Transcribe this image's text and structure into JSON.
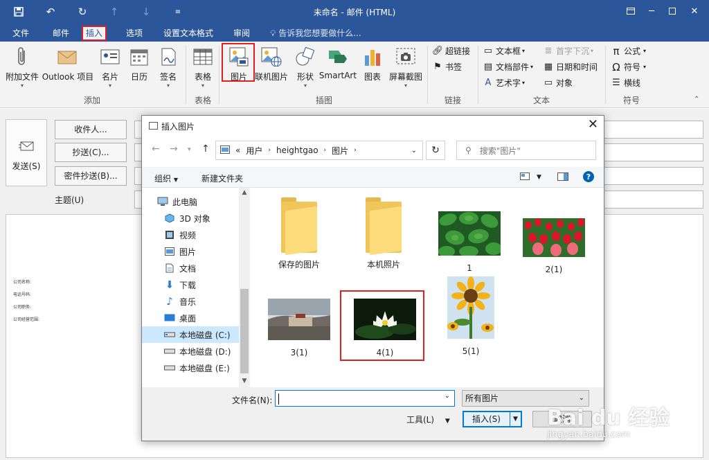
{
  "window": {
    "title": "未命名 - 邮件 (HTML)"
  },
  "ribbon_tabs": [
    "文件",
    "邮件",
    "插入",
    "选项",
    "设置文本格式",
    "审阅"
  ],
  "tell_me": "告诉我您想要做什么...",
  "ribbon": {
    "add": {
      "attach": "附加文件",
      "outlook_item": "Outlook 项目",
      "card": "名片",
      "calendar": "日历",
      "signature": "签名",
      "group": "添加"
    },
    "tables": {
      "table": "表格",
      "group": "表格"
    },
    "illustrations": {
      "picture": "图片",
      "online_picture": "联机图片",
      "shapes": "形状",
      "smartart": "SmartArt",
      "chart": "图表",
      "screenshot": "屏幕截图",
      "group": "插图"
    },
    "links": {
      "hyperlink": "超链接",
      "bookmark": "书签",
      "group": "链接"
    },
    "text": {
      "textbox": "文本框",
      "quick_parts": "文档部件",
      "wordart": "艺术字",
      "dropcap": "首字下沉",
      "datetime": "日期和时间",
      "object": "对象",
      "group": "文本"
    },
    "symbols": {
      "equation": "公式",
      "symbol": "符号",
      "line": "横线",
      "group": "符号"
    }
  },
  "compose": {
    "send": "发送(S)",
    "to": "收件人...",
    "cc": "抄送(C)...",
    "bcc": "密件抄送(B)...",
    "subject": "主题(U)",
    "body_lines": [
      "公司名称:",
      "电话号码:",
      "公司职务:",
      "公司经营范围:"
    ]
  },
  "dialog": {
    "title": "插入图片",
    "path": [
      "用户",
      "heightgao",
      "图片"
    ],
    "path_prefix": "«",
    "search_placeholder": "搜索\"图片\"",
    "organize": "组织",
    "new_folder": "新建文件夹",
    "nav_items": [
      {
        "label": "此电脑",
        "icon": "computer-icon"
      },
      {
        "label": "3D 对象",
        "icon": "3d-objects-icon"
      },
      {
        "label": "视频",
        "icon": "video-icon"
      },
      {
        "label": "图片",
        "icon": "pictures-icon"
      },
      {
        "label": "文档",
        "icon": "documents-icon"
      },
      {
        "label": "下载",
        "icon": "download-icon"
      },
      {
        "label": "音乐",
        "icon": "music-icon"
      },
      {
        "label": "桌面",
        "icon": "desktop-icon"
      },
      {
        "label": "本地磁盘 (C:)",
        "icon": "drive-icon",
        "selected": true
      },
      {
        "label": "本地磁盘 (D:)",
        "icon": "drive-icon"
      },
      {
        "label": "本地磁盘 (E:)",
        "icon": "drive-icon"
      }
    ],
    "files": [
      {
        "name": "保存的图片",
        "kind": "folder"
      },
      {
        "name": "本机照片",
        "kind": "folder"
      },
      {
        "name": "1",
        "kind": "image"
      },
      {
        "name": "2(1)",
        "kind": "image"
      },
      {
        "name": "3(1)",
        "kind": "image"
      },
      {
        "name": "4(1)",
        "kind": "image",
        "highlighted": true
      },
      {
        "name": "5(1)",
        "kind": "image"
      }
    ],
    "filename_label": "文件名(N):",
    "filename_value": "",
    "filter": "所有图片",
    "tools": "工具(L)",
    "insert": "插入(S)",
    "cancel": "取消"
  },
  "watermark": {
    "line1": "Bai du 经验",
    "line2": "jingyan.baidu.com"
  },
  "colors": {
    "accent": "#2b579a",
    "highlight": "#e02020",
    "selection": "#cce8ff",
    "dialog_accent": "#0078d7"
  }
}
